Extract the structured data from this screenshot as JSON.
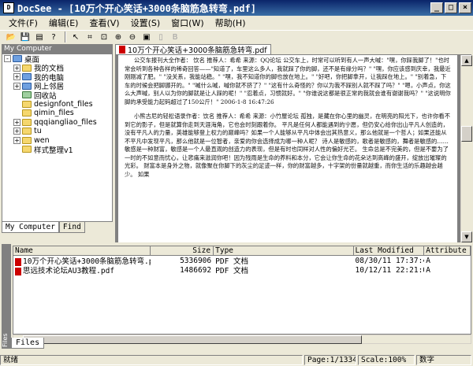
{
  "window": {
    "title": "DocSee - [10万个开心笑话+3000条脑筋急转弯.pdf]",
    "controls": [
      "_",
      "□",
      "×"
    ]
  },
  "menu": [
    "文件(F)",
    "编辑(E)",
    "查看(V)",
    "设置(S)",
    "窗口(W)",
    "帮助(H)"
  ],
  "toolbar": {
    "icons": [
      "open-icon",
      "save-icon",
      "print-icon",
      "help-icon",
      "select-icon",
      "snapshot-icon",
      "zoom-select-icon",
      "zoom-in-icon",
      "zoom-out-icon",
      "fit-page-icon",
      "actual-size-icon",
      "bold-icon"
    ]
  },
  "left_panel": {
    "header": "My Computer",
    "tree": [
      {
        "label": "桌面",
        "level": 0,
        "expander": "-",
        "icon": "blue"
      },
      {
        "label": "我的文档",
        "level": 1,
        "expander": "+",
        "icon": "yellow"
      },
      {
        "label": "我的电脑",
        "level": 1,
        "expander": "+",
        "icon": "blue"
      },
      {
        "label": "网上邻居",
        "level": 1,
        "expander": "+",
        "icon": "blue"
      },
      {
        "label": "回收站",
        "level": 1,
        "expander": "",
        "icon": "recycle"
      },
      {
        "label": "designfont_files",
        "level": 1,
        "expander": "",
        "icon": "yellow"
      },
      {
        "label": "qimin_files",
        "level": 1,
        "expander": "",
        "icon": "yellow"
      },
      {
        "label": "qqqiangliao_files",
        "level": 1,
        "expander": "+",
        "icon": "yellow"
      },
      {
        "label": "tu",
        "level": 1,
        "expander": "+",
        "icon": "yellow"
      },
      {
        "label": "wen",
        "level": 1,
        "expander": "+",
        "icon": "yellow"
      },
      {
        "label": "样式整理v1",
        "level": 1,
        "expander": "",
        "icon": "yellow"
      }
    ],
    "tabs": [
      "My Computer",
      "Find"
    ]
  },
  "document": {
    "tab_label": "10万个开心笑话+3000条脑筋急转弯.pdf",
    "paragraphs": [
      "公交车报刊大全作者：  饮名        推荐人：希希       来源：QQ论坛        公交车上，时常可以听到有人一声大喊：\"嘿，你踩我脚了！\"也时常会听到各种各样的稀奇回答——\"知道了，车里这么多人，我就踩了你的脚，还不是有缘分吗？\"  \"嘿，你应该感到庆幸，我最近刚刚减了肥。\"  \"没关系，我能站稳。\"  \"嘿，我不知道你的脚也放在地上。\"  \"好吧，你把脚拿开，让我踩在地上。\"  \"别着急，下车的时候会把脚挪开的。\"  \"喊什么喊，喊你就不挤了？\"  \"这有什么奇怪的？你以为我不踩别人就不踩了吗？\"  \"嗯，小声点，你这么大声喊，别人以为你的脚就是让人踩的呢！\"  \"忍着点，习惯就好。\"  \"你谁说这都是很正常的我就会谁有谢谢我吗？\"  \"这说明你脚的承受能力起码超过了150公斤！\"  2006-1-8 16:47:26",
      "小熊古尼的轻松语录作者：饮名        推荐人：希希       来源：小竹屋论坛        孤独，是藏在你心里的幽灵，在明亮的阳光下，也许你看不到它的影子，但是就算你走到天涯海角，它也会时刻跟着你。    平凡是任何人都能遇到的宁愿，但仍安心给你出山平凡人创造的，没有平凡人的力量，英雄能够登上权力的巅峰吗？如果一个人能够从平凡中体会出其热意义，那么他就是一个哲人；如果还能从不平凡中发现平凡，那么他就是一位智者，亲爱的你会选择成为哪一种人呢？    诗人是敏感的，歌者是敏感的，舞者是敏感的……敏感是一种财富，敏感是一个人最直观的创造力的表现，但是有时也同样对人性的偏好光芒。    生命总是不完美的，但是不要为了一时的不如意而忧心，让悲痛来滋润你吧！因为残雨是生命的养料和本分，它会让你生命的花朵达到高峰的盛开，绽放出璀璨的光彩。    财富本是身外之物，就像聚在你脚下的灰尘的足迹一样，你的财富越多，十字架的份量就越重，而你生活的乐趣越会越少。    如果"
    ]
  },
  "files_panel": {
    "side_label": "Files",
    "columns": [
      "Name",
      "Size",
      "Type",
      "Last Modified",
      "Attribute"
    ],
    "rows": [
      {
        "name": "10万个开心笑话+3000条脑筋急转弯.pdf",
        "size": "5336906",
        "type": "PDF 文档",
        "modified": "08/30/11 17:37:40",
        "attr": "A"
      },
      {
        "name": "思远技术论坛AU3教程.pdf",
        "size": "1486692",
        "type": "PDF 文档",
        "modified": "10/12/11 22:21:06",
        "attr": "A"
      }
    ],
    "tab": "Files"
  },
  "status": {
    "ready": "就绪",
    "page": "Page:1/1334",
    "scale": "Scale:100%",
    "numlock": "数字"
  }
}
